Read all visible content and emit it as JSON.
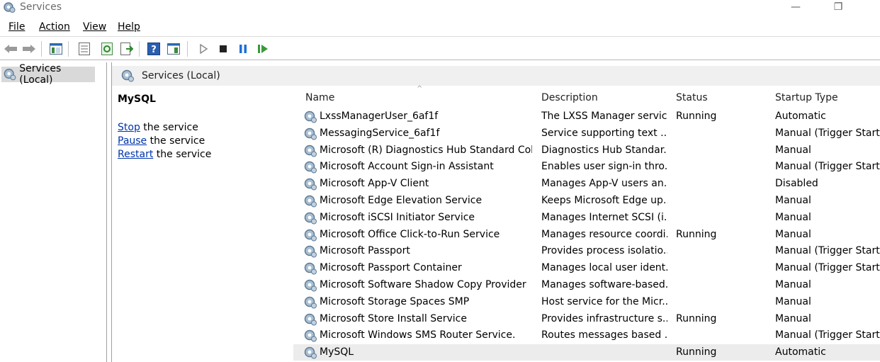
{
  "window": {
    "title": "Services",
    "minimize": "—",
    "restore": "❐"
  },
  "menu": [
    "File",
    "Action",
    "View",
    "Help"
  ],
  "toolbar": {
    "icons": [
      "back-arrow-icon",
      "forward-arrow-icon",
      "console-tree-icon",
      "properties-icon",
      "refresh-icon",
      "export-list-icon",
      "help-icon",
      "show-hide-pane-icon",
      "start-service-icon",
      "stop-service-icon",
      "pause-service-icon",
      "resume-service-icon"
    ]
  },
  "tree": {
    "item": "Services (Local)"
  },
  "pane": {
    "header": "Services (Local)"
  },
  "details": {
    "service_name": "MySQL",
    "actions": [
      {
        "link": "Stop",
        "rest": " the service"
      },
      {
        "link": "Pause",
        "rest": " the service"
      },
      {
        "link": "Restart",
        "rest": " the service"
      }
    ]
  },
  "columns": {
    "name": "Name",
    "description": "Description",
    "status": "Status",
    "startup": "Startup Type",
    "sort_indicator": "^"
  },
  "rows": [
    {
      "name": "LxssManagerUser_6af1f",
      "description": "The LXSS Manager servic...",
      "status": "Running",
      "startup": "Automatic"
    },
    {
      "name": "MessagingService_6af1f",
      "description": "Service supporting text ...",
      "status": "",
      "startup": "Manual (Trigger Start)"
    },
    {
      "name": "Microsoft (R) Diagnostics Hub Standard Colle...",
      "description": "Diagnostics Hub Standar...",
      "status": "",
      "startup": "Manual"
    },
    {
      "name": "Microsoft Account Sign-in Assistant",
      "description": "Enables user sign-in thro...",
      "status": "",
      "startup": "Manual (Trigger Start)"
    },
    {
      "name": "Microsoft App-V Client",
      "description": "Manages App-V users an...",
      "status": "",
      "startup": "Disabled"
    },
    {
      "name": "Microsoft Edge Elevation Service",
      "description": "Keeps Microsoft Edge up...",
      "status": "",
      "startup": "Manual"
    },
    {
      "name": "Microsoft iSCSI Initiator Service",
      "description": "Manages Internet SCSI (i...",
      "status": "",
      "startup": "Manual"
    },
    {
      "name": "Microsoft Office Click-to-Run Service",
      "description": "Manages resource coordi...",
      "status": "Running",
      "startup": "Manual"
    },
    {
      "name": "Microsoft Passport",
      "description": "Provides process isolatio...",
      "status": "",
      "startup": "Manual (Trigger Start)"
    },
    {
      "name": "Microsoft Passport Container",
      "description": "Manages local user ident...",
      "status": "",
      "startup": "Manual (Trigger Start)"
    },
    {
      "name": "Microsoft Software Shadow Copy Provider",
      "description": "Manages software-based...",
      "status": "",
      "startup": "Manual"
    },
    {
      "name": "Microsoft Storage Spaces SMP",
      "description": "Host service for the Micr...",
      "status": "",
      "startup": "Manual"
    },
    {
      "name": "Microsoft Store Install Service",
      "description": "Provides infrastructure s...",
      "status": "Running",
      "startup": "Manual"
    },
    {
      "name": "Microsoft Windows SMS Router Service.",
      "description": "Routes messages based ...",
      "status": "",
      "startup": "Manual (Trigger Start)"
    },
    {
      "name": "MySQL",
      "description": "",
      "status": "Running",
      "startup": "Automatic",
      "selected": true
    }
  ],
  "colors": {
    "selected_row": "#ececec",
    "link": "#0033aa",
    "play_green": "#3a9a3a",
    "pause_blue": "#1e6fd9"
  }
}
